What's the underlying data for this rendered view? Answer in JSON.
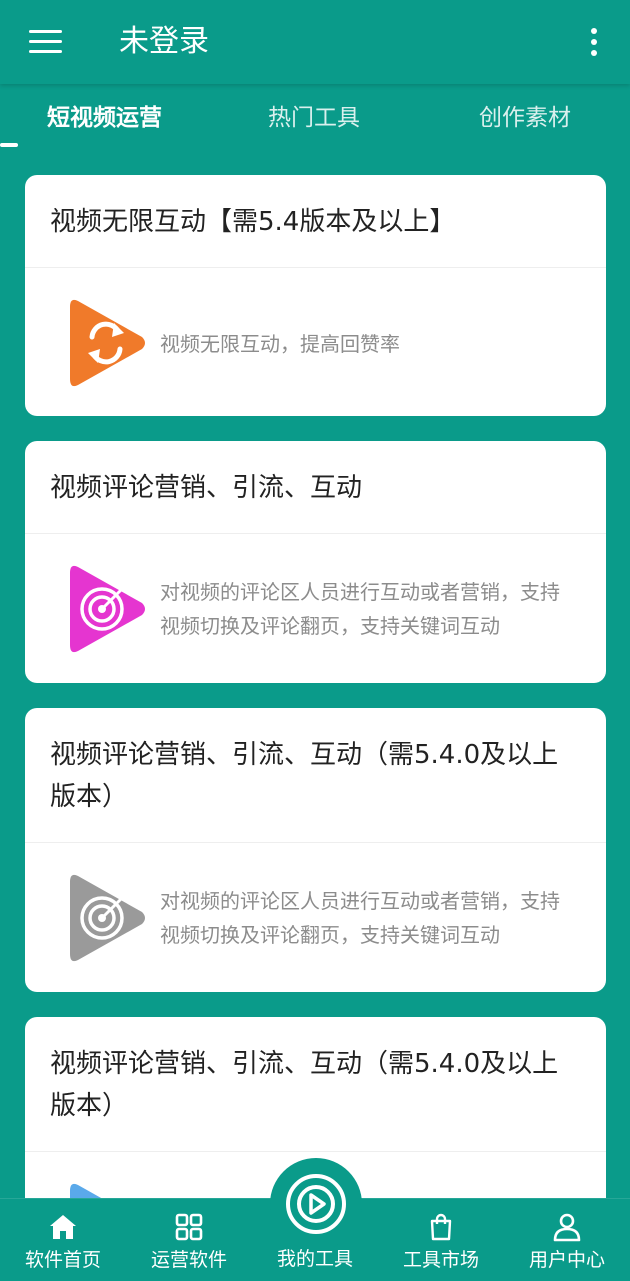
{
  "header": {
    "title": "未登录",
    "menu_icon": "hamburger-menu-icon",
    "more_icon": "more-vertical-icon"
  },
  "tabs": [
    {
      "label": "短视频运营",
      "active": true
    },
    {
      "label": "热门工具",
      "active": false
    },
    {
      "label": "创作素材",
      "active": false
    }
  ],
  "cards": [
    {
      "title": "视频无限互动【需5.4版本及以上】",
      "description": "视频无限互动，提高回赞率",
      "icon": "refresh-play-icon",
      "icon_color": "#f07a2a"
    },
    {
      "title": "视频评论营销、引流、互动",
      "description": "对视频的评论区人员进行互动或者营销，支持视频切换及评论翻页，支持关键词互动",
      "icon": "target-play-icon",
      "icon_color": "#e535d0"
    },
    {
      "title": "视频评论营销、引流、互动（需5.4.0及以上版本）",
      "description": "对视频的评论区人员进行互动或者营销，支持视频切换及评论翻页，支持关键词互动",
      "icon": "target-play-icon",
      "icon_color": "#9a9a9a"
    },
    {
      "title": "视频评论营销、引流、互动（需5.4.0及以上版本）",
      "description": "",
      "icon": "play-icon",
      "icon_color": "#5aa9ea"
    }
  ],
  "bottom_nav": [
    {
      "label": "软件首页",
      "icon": "home-icon"
    },
    {
      "label": "运营软件",
      "icon": "grid-icon"
    },
    {
      "label": "我的工具",
      "icon": "play-circle-icon"
    },
    {
      "label": "工具市场",
      "icon": "shopping-bag-icon"
    },
    {
      "label": "用户中心",
      "icon": "user-icon"
    }
  ],
  "colors": {
    "primary": "#0a9b8a",
    "card_bg": "#ffffff",
    "title_text": "#222222",
    "desc_text": "#8c8c8c"
  }
}
